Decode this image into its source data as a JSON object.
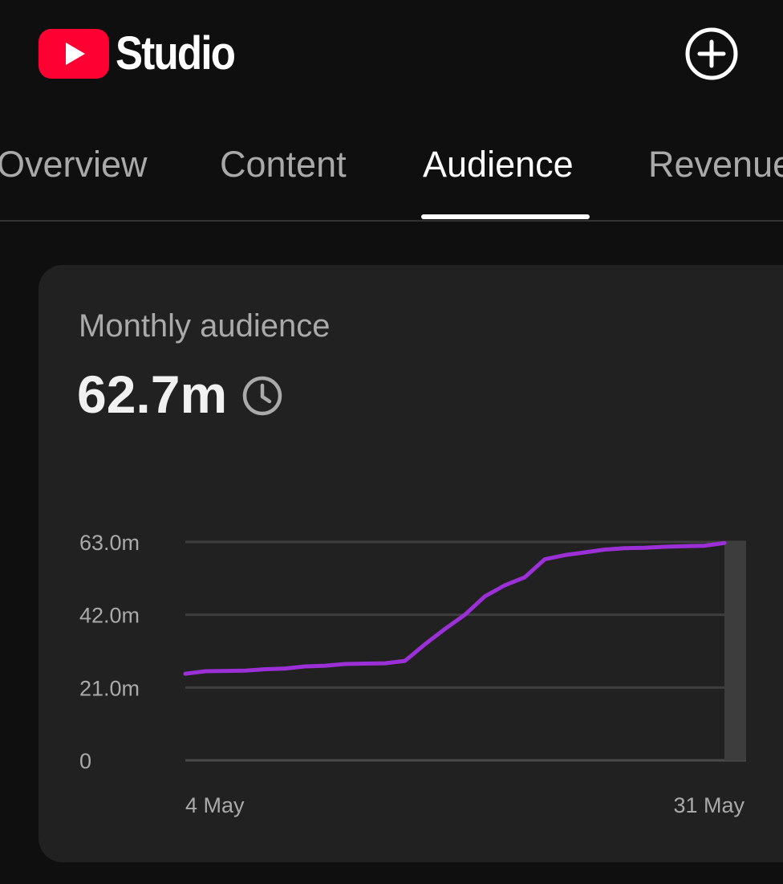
{
  "header": {
    "app_name": "Studio",
    "logo_icon": "youtube-play-icon",
    "create_icon": "plus-circle-icon",
    "brand_color": "#ff0033"
  },
  "tabs": [
    {
      "label": "Overview",
      "active": false
    },
    {
      "label": "Content",
      "active": false
    },
    {
      "label": "Audience",
      "active": true
    },
    {
      "label": "Revenue",
      "active": false
    }
  ],
  "card": {
    "title": "Monthly audience",
    "value": "62.7m",
    "value_icon": "clock-icon"
  },
  "chart_data": {
    "type": "line",
    "y_ticks": [
      "0",
      "21.0m",
      "42.0m",
      "63.0m"
    ],
    "y_tick_values": [
      0,
      21,
      42,
      63
    ],
    "ylim": [
      0,
      63
    ],
    "x_labels": [
      "4 May",
      "31 May"
    ],
    "x_label_days": [
      4,
      31
    ],
    "grid": true,
    "line_color": "#9b30d6",
    "highlight_color": "#3d3d3d",
    "series": [
      {
        "x": [
          4,
          5,
          6,
          7,
          8,
          9,
          10,
          11,
          12,
          13,
          14,
          15,
          16,
          17,
          18,
          19,
          20,
          21,
          22,
          23,
          24,
          25,
          26,
          27,
          28,
          29,
          30,
          31
        ],
        "values": [
          25,
          25.7,
          25.8,
          25.9,
          26.3,
          26.5,
          27.1,
          27.3,
          27.8,
          27.9,
          28.0,
          28.7,
          33.5,
          37.9,
          42.0,
          47.3,
          50.5,
          52.8,
          58.0,
          59.2,
          60.0,
          60.8,
          61.2,
          61.3,
          61.6,
          61.8,
          61.9,
          62.7
        ]
      }
    ]
  }
}
